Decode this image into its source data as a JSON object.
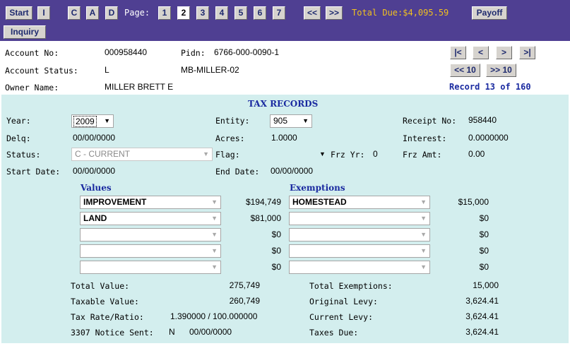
{
  "toolbar": {
    "start": "Start",
    "i": "I",
    "c": "C",
    "a": "A",
    "d": "D",
    "page_label": "Page:",
    "pages": [
      "1",
      "2",
      "3",
      "4",
      "5",
      "6",
      "7"
    ],
    "prev": "<<",
    "next": ">>",
    "total_due": "Total Due:$4,095.59",
    "payoff": "Payoff",
    "inquiry": "Inquiry"
  },
  "account": {
    "account_no_label": "Account No:",
    "account_no": "000958440",
    "pidn_label": "Pidn:",
    "pidn": "6766-000-0090-1",
    "status_label": "Account Status:",
    "status": "L",
    "mb": "MB-MILLER-02",
    "owner_label": "Owner Name:",
    "owner": "MILLER BRETT E",
    "nav": [
      "|<",
      "<",
      ">",
      ">|",
      "<< 10",
      ">> 10"
    ],
    "record": "Record 13 of 160"
  },
  "tax": {
    "title": "TAX RECORDS",
    "year_label": "Year:",
    "year": "2009",
    "entity_label": "Entity:",
    "entity": "905",
    "receipt_label": "Receipt No:",
    "receipt": "958440",
    "delq_label": "Delq:",
    "delq": "00/00/0000",
    "acres_label": "Acres:",
    "acres": "1.0000",
    "interest_label": "Interest:",
    "interest": "0.0000000",
    "status_label": "Status:",
    "status": "C - CURRENT",
    "flag_label": "Flag:",
    "frz_yr_label": "Frz Yr:",
    "frz_yr": "0",
    "frz_amt_label": "Frz Amt:",
    "frz_amt": "0.00",
    "start_date_label": "Start Date:",
    "start_date": "00/00/0000",
    "end_date_label": "End Date:",
    "end_date": "00/00/0000",
    "values_header": "Values",
    "exemptions_header": "Exemptions",
    "values": [
      {
        "name": "IMPROVEMENT",
        "amount": "$194,749"
      },
      {
        "name": "LAND",
        "amount": "$81,000"
      },
      {
        "name": "",
        "amount": "$0"
      },
      {
        "name": "",
        "amount": "$0"
      },
      {
        "name": "",
        "amount": "$0"
      }
    ],
    "exemptions": [
      {
        "name": "HOMESTEAD",
        "amount": "$15,000"
      },
      {
        "name": "",
        "amount": "$0"
      },
      {
        "name": "",
        "amount": "$0"
      },
      {
        "name": "",
        "amount": "$0"
      },
      {
        "name": "",
        "amount": "$0"
      }
    ],
    "total_value_label": "Total Value:",
    "total_value": "275,749",
    "taxable_value_label": "Taxable Value:",
    "taxable_value": "260,749",
    "tax_rate_label": "Tax Rate/Ratio:",
    "tax_rate": "1.390000 / 100.000000",
    "notice_label": "3307 Notice Sent:",
    "notice_flag": "N",
    "notice_date": "00/00/0000",
    "total_exemptions_label": "Total Exemptions:",
    "total_exemptions": "15,000",
    "original_levy_label": "Original Levy:",
    "original_levy": "3,624.41",
    "current_levy_label": "Current Levy:",
    "current_levy": "3,624.41",
    "taxes_due_label": "Taxes Due:",
    "taxes_due": "3,624.41"
  }
}
